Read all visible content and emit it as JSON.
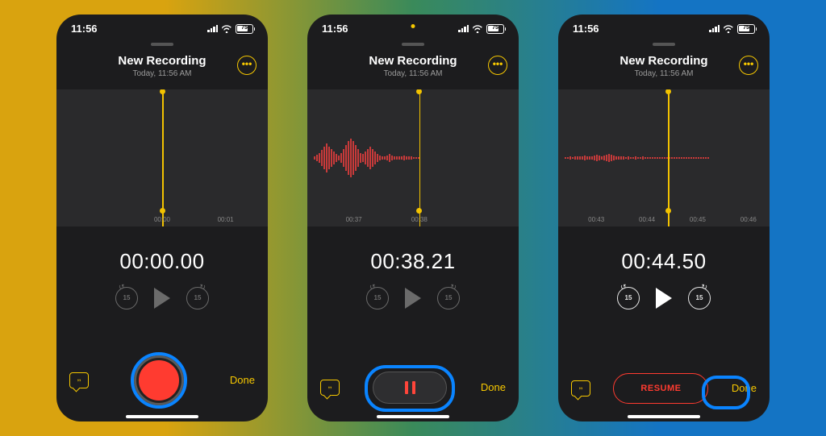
{
  "screens": [
    {
      "status": {
        "time": "11:56",
        "battery_pct": "75",
        "recording_indicator": false
      },
      "title": "New Recording",
      "subtitle": "Today, 11:56 AM",
      "timer": "00:00.00",
      "ticks": [
        "00:00",
        "00:01"
      ],
      "tick_positions": [
        50,
        80
      ],
      "playhead_pct": 50,
      "waveform": [],
      "skip_seconds": "15",
      "transport_state": "dim",
      "bottom_mode": "record",
      "done_label": "Done",
      "highlight": "record"
    },
    {
      "status": {
        "time": "11:56",
        "battery_pct": "75",
        "recording_indicator": true
      },
      "title": "New Recording",
      "subtitle": "Today, 11:56 AM",
      "timer": "00:38.21",
      "ticks": [
        "00:37",
        "00:38"
      ],
      "tick_positions": [
        22,
        53
      ],
      "playhead_pct": 53,
      "waveform": [
        3,
        5,
        8,
        12,
        18,
        22,
        18,
        14,
        10,
        6,
        4,
        8,
        14,
        20,
        26,
        30,
        26,
        20,
        14,
        8,
        6,
        10,
        14,
        18,
        14,
        10,
        6,
        4,
        3,
        2,
        4,
        6,
        4,
        3,
        2,
        2,
        3,
        4,
        3,
        2,
        2,
        1,
        1,
        1
      ],
      "skip_seconds": "15",
      "transport_state": "dim",
      "bottom_mode": "pause",
      "done_label": "Done",
      "highlight": "pause"
    },
    {
      "status": {
        "time": "11:56",
        "battery_pct": "75",
        "recording_indicator": false
      },
      "title": "New Recording",
      "subtitle": "Today, 11:56 AM",
      "timer": "00:44.50",
      "ticks": [
        "00:43",
        "00:44",
        "00:45",
        "00:46"
      ],
      "tick_positions": [
        18,
        42,
        66,
        90
      ],
      "playhead_pct": 52,
      "waveform": [
        1,
        1,
        2,
        1,
        2,
        3,
        2,
        3,
        4,
        3,
        2,
        3,
        4,
        5,
        4,
        3,
        4,
        5,
        6,
        5,
        4,
        3,
        2,
        3,
        2,
        1,
        2,
        1,
        1,
        2,
        1,
        1,
        2,
        1,
        1,
        1,
        1,
        1,
        1,
        1,
        1,
        1,
        1,
        1,
        1,
        1,
        1,
        1,
        1,
        1,
        1,
        1,
        1,
        1,
        1,
        1,
        1,
        1,
        1,
        1
      ],
      "skip_seconds": "15",
      "transport_state": "light",
      "bottom_mode": "resume",
      "resume_label": "RESUME",
      "done_label": "Done",
      "highlight": "done"
    }
  ]
}
